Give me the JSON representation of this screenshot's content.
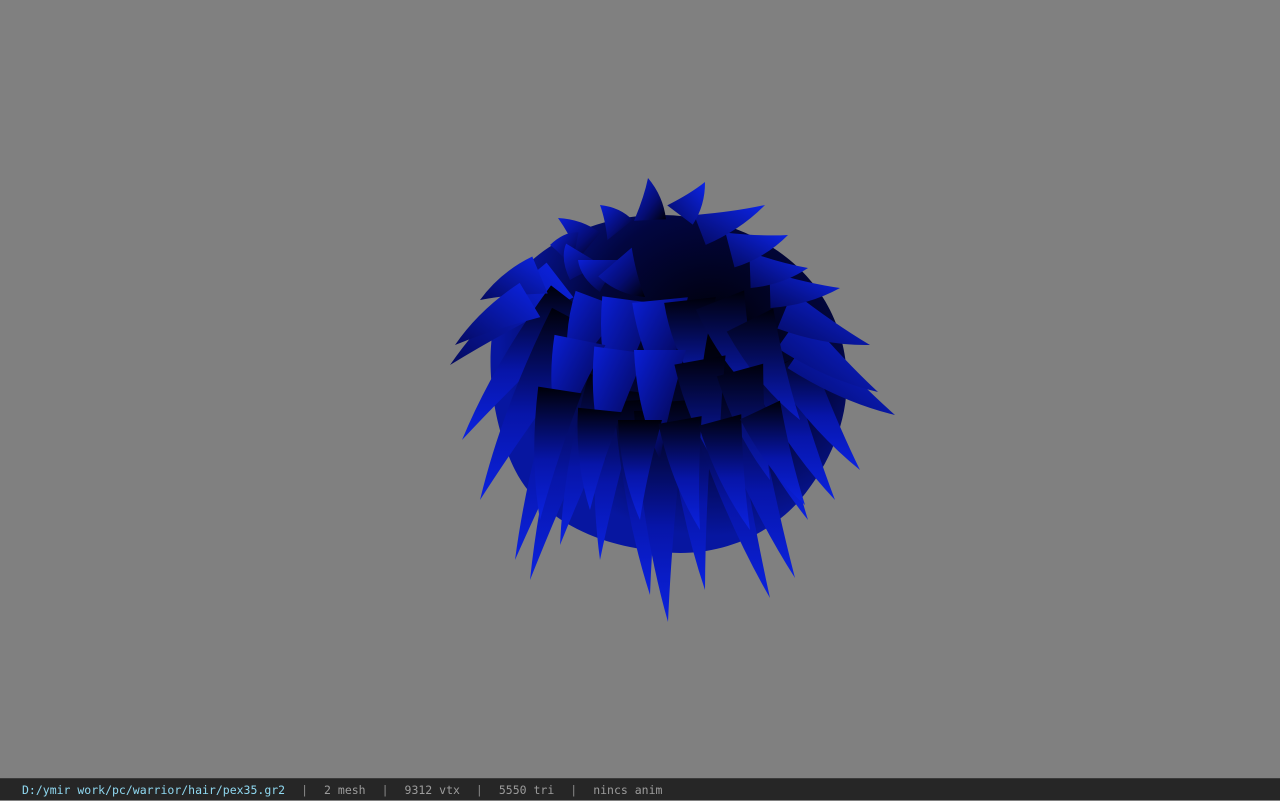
{
  "viewport": {
    "background": "#808080",
    "model": {
      "name": "hair-mesh",
      "primary_color": "#0a1ee6",
      "shadow_color": "#000010"
    }
  },
  "statusbar": {
    "path": "D:/ymir work/pc/warrior/hair/pex35.gr2",
    "separator": "|",
    "mesh": "2 mesh",
    "vtx": "9312 vtx",
    "tri": "5550 tri",
    "anim": "nincs anim",
    "path_color": "#8fd8f0"
  }
}
